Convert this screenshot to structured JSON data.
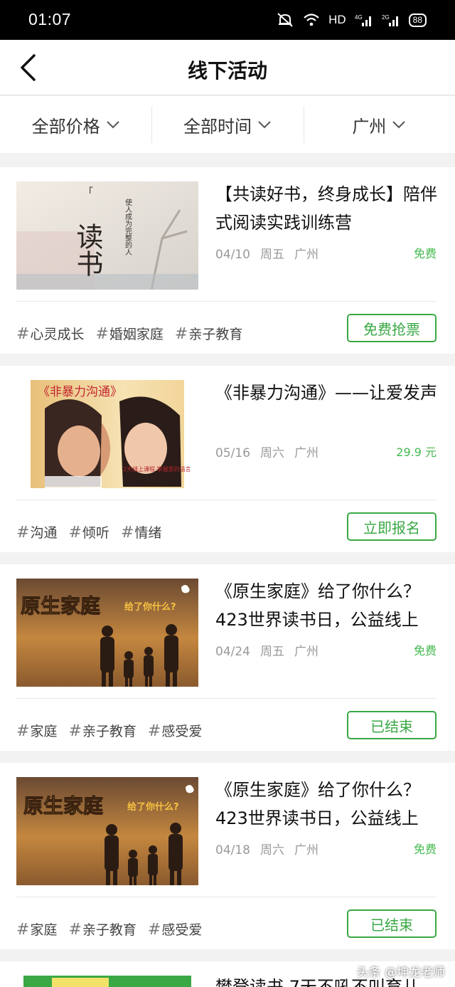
{
  "status": {
    "time": "01:07",
    "network": "HD",
    "battery": "88"
  },
  "nav": {
    "title": "线下活动"
  },
  "filters": [
    {
      "label": "全部价格"
    },
    {
      "label": "全部时间"
    },
    {
      "label": "广州"
    }
  ],
  "events": [
    {
      "title": "【共读好书，终身成长】陪伴式阅读实践训练营",
      "date": "04/10",
      "weekday": "周五",
      "city": "广州",
      "price": "免费",
      "tags": [
        "心灵成长",
        "婚姻家庭",
        "亲子教育"
      ],
      "button": "免费抢票",
      "image_text": {
        "main": "读书",
        "side": "使人成为完整的人"
      }
    },
    {
      "title": "《非暴力沟通》——让爱发声",
      "date": "05/16",
      "weekday": "周六",
      "city": "广州",
      "price": "29.9 元",
      "tags": [
        "沟通",
        "倾听",
        "情绪"
      ],
      "button": "立即报名",
      "image_text": {
        "main": "《非暴力沟通》",
        "side": "2天线上课程 掌握爱的语言"
      }
    },
    {
      "title": "《原生家庭》给了你什么？423世界读书日，公益线上",
      "date": "04/24",
      "weekday": "周五",
      "city": "广州",
      "price": "免费",
      "tags": [
        "家庭",
        "亲子教育",
        "感受爱"
      ],
      "button": "已结束",
      "image_text": {
        "main": "原生家庭",
        "side": "给了你什么?"
      }
    },
    {
      "title": "《原生家庭》给了你什么？423世界读书日，公益线上",
      "date": "04/18",
      "weekday": "周六",
      "city": "广州",
      "price": "免费",
      "tags": [
        "家庭",
        "亲子教育",
        "感受爱"
      ],
      "button": "已结束",
      "image_text": {
        "main": "原生家庭",
        "side": "给了你什么?"
      }
    }
  ],
  "partial_next": {
    "title": "樊登读书 7天不吼不叫育儿"
  },
  "watermark": "头条 @坤龙老师",
  "colors": {
    "accent": "#3aa845",
    "price": "#43b94e"
  }
}
